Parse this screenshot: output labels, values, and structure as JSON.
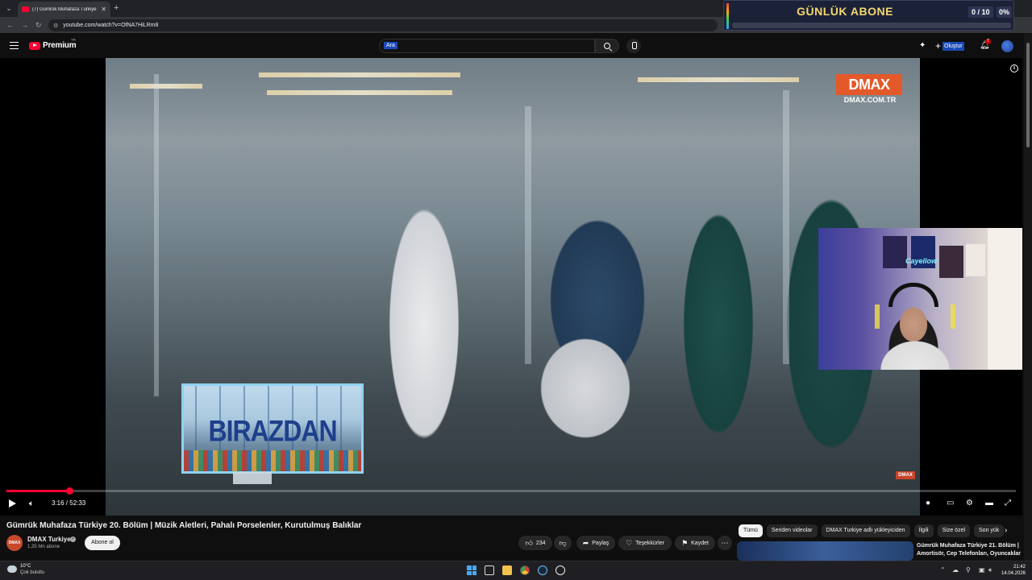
{
  "browser": {
    "tab_title": "(7) Gümrük Muhafaza Türkiye 2",
    "url": "youtube.com/watch?v=OfNA7HiLRm8"
  },
  "overlay_widget": {
    "label": "GÜNLÜK ABONE",
    "count": "0 / 10",
    "percent": "0%",
    "progress_fraction": 0
  },
  "header": {
    "logo_text": "Premium",
    "logo_country": "TR",
    "search_placeholder": "Ara",
    "create_label": "Oluştur",
    "notification_count": "7"
  },
  "player": {
    "brand": "DMAX",
    "brand_url": "DMAX.COM.TR",
    "promo_text": "BIRAZDAN",
    "webcam_neon": "Cayellow",
    "time_display": "3:16 / 52:33",
    "progress_fraction": 0.062
  },
  "video": {
    "title": "Gümrük Muhafaza Türkiye 20. Bölüm | Müzik Aletleri, Pahalı Porselenler, Kurutulmuş Balıklar",
    "channel_name": "DMAX Turkiye",
    "channel_avatar_text": "DMAX",
    "subscribers": "1,35 Mn abone",
    "subscribe_label": "Abone ol",
    "likes": "234",
    "share_label": "Paylaş",
    "thanks_label": "Teşekkürler",
    "save_label": "Kaydet"
  },
  "chips": [
    "Tümü",
    "Seriden videolar",
    "DMAX Turkiye adlı yükleyiciden",
    "İlgili",
    "Size özel",
    "Son yük"
  ],
  "recommendation": {
    "title": "Gümrük Muhafaza Türkiye 21. Bölüm | Amortisör, Cep Telefonları, Oyuncaklar"
  },
  "taskbar": {
    "temperature": "10°C",
    "weather": "Çok bulutlu",
    "time": "21:42",
    "date": "14.04.2026"
  },
  "colors": {
    "youtube_red": "#ff0033",
    "dmax_orange": "#e4592a",
    "widget_gold": "#f5d76e"
  }
}
